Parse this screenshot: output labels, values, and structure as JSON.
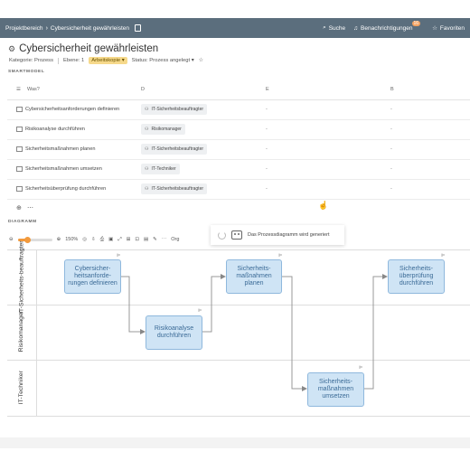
{
  "topbar": {
    "breadcrumb_parent": "Projektbereich",
    "breadcrumb_current": "Cybersicherheit gewährleisten",
    "search": "Suche",
    "notifications": "Benachrichtigungen",
    "notifications_count": "16",
    "favorites": "Favoriten"
  },
  "header": {
    "title": "Cybersicherheit gewährleisten",
    "category": "Kategorie: Prozess",
    "level": "Ebene: 1",
    "scope": "Arbeitskopie",
    "status": "Status: Prozess angelegt"
  },
  "smartmodel": {
    "label": "SMARTMODEL",
    "columns": [
      "Was?",
      "D",
      "E",
      "B"
    ],
    "rows": [
      {
        "task": "Cybersicherheitsanforderungen definieren",
        "role": "IT-Sicherheitsbeauftragter",
        "e": "-",
        "b": "-"
      },
      {
        "task": "Risikoanalyse durchführen",
        "role": "Risikomanager",
        "e": "-",
        "b": "-"
      },
      {
        "task": "Sicherheitsmaßnahmen planen",
        "role": "IT-Sicherheitsbeauftragter",
        "e": "-",
        "b": "-"
      },
      {
        "task": "Sicherheitsmaßnahmen umsetzen",
        "role": "IT-Techniker",
        "e": "-",
        "b": "-"
      },
      {
        "task": "Sicherheitsüberprüfung durchführen",
        "role": "IT-Sicherheitsbeauftragter",
        "e": "-",
        "b": "-"
      }
    ]
  },
  "diagram": {
    "label": "DIAGRAMM",
    "zoom": "150%",
    "toolbar_text": "Org",
    "toast": "Das Prozessdiagramm wird generiert",
    "lanes": [
      "IT-Sicherheits-beauftragter",
      "Risikomanager",
      "IT-Techniker"
    ],
    "nodes": [
      "Cybersicher-heitsanforde-rungen definieren",
      "Risikoanalyse durchführen",
      "Sicherheits-maßnahmen planen",
      "Sicherheits-maßnahmen umsetzen",
      "Sicherheits-überprüfung durchführen"
    ]
  },
  "colors": {
    "topbar": "#5b6e7d",
    "accent": "#f29a3d",
    "node_fill": "#cfe4f5",
    "node_border": "#8fb8dd"
  }
}
